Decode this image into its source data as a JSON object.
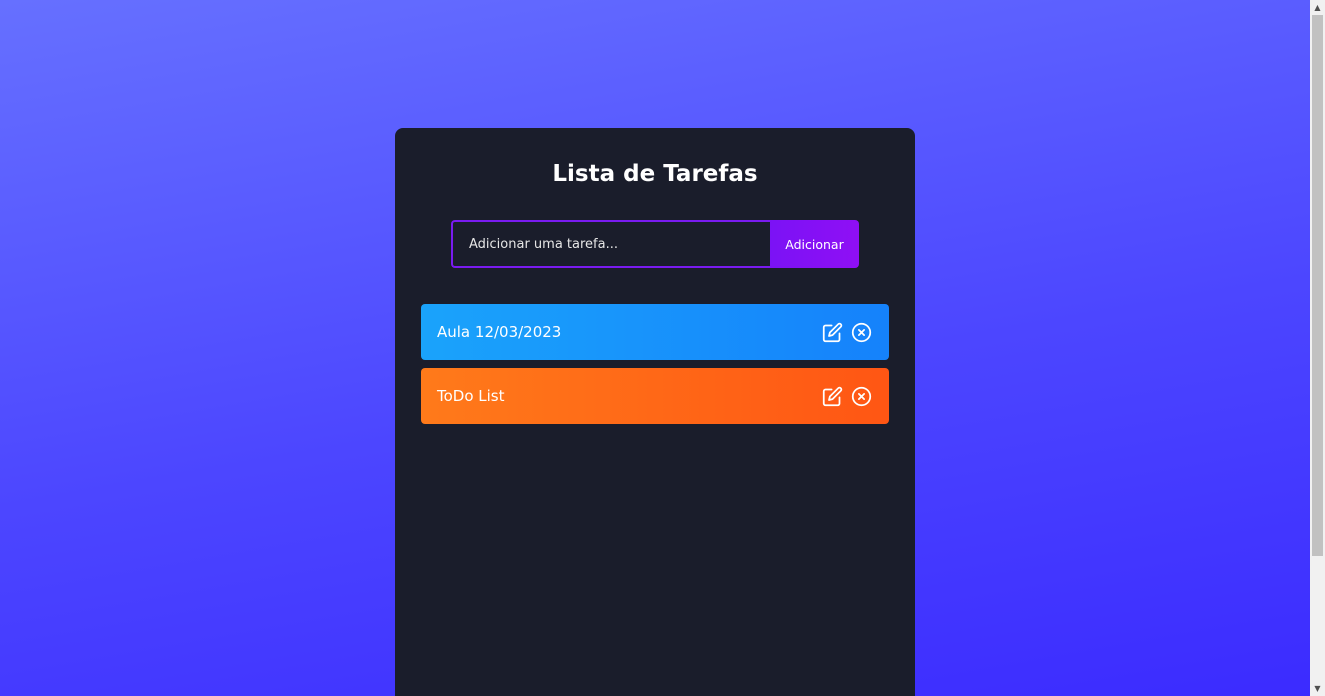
{
  "app": {
    "title": "Lista de Tarefas"
  },
  "form": {
    "input_placeholder": "Adicionar uma tarefa...",
    "add_button_label": "Adicionar"
  },
  "tasks": [
    {
      "text": "Aula 12/03/2023",
      "color": "#1a96fb",
      "edit_icon": "edit-icon",
      "delete_icon": "close-circle-icon"
    },
    {
      "text": "ToDo List",
      "color": "#ff6a17",
      "edit_icon": "edit-icon",
      "delete_icon": "close-circle-icon"
    }
  ],
  "colors": {
    "background_top": "#6670ff",
    "background_bottom": "#3b2bff",
    "card": "#1a1d2b",
    "accent": "#7b12f5"
  },
  "scrollbar": {
    "up_glyph": "▲",
    "down_glyph": "▼"
  }
}
